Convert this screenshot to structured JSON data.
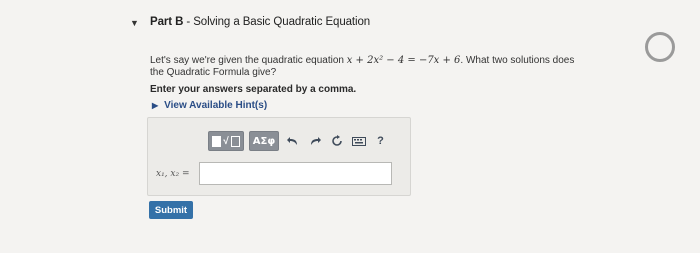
{
  "part": {
    "expand_icon": "caret-down-icon",
    "label": "Part B",
    "separator": " - ",
    "title": "Solving a Basic Quadratic Equation"
  },
  "question": {
    "text_before": "Let's say we're given the quadratic equation ",
    "equation": "x + 2x² − 4 = −7x + 6",
    "text_after": ". What two solutions does the Quadratic Formula give?"
  },
  "instruction": "Enter your answers separated by a comma.",
  "hints": {
    "icon": "triangle-right-icon",
    "label": "View Available Hint(s)"
  },
  "toolbar": {
    "template_label": "√",
    "greek_label": "ΑΣφ",
    "undo_icon": "undo-icon",
    "redo_icon": "redo-icon",
    "reset_icon": "reset-icon",
    "keyboard_icon": "keyboard-icon",
    "help_label": "?"
  },
  "answer": {
    "variable_label": "x₁, x₂ =",
    "value": ""
  },
  "submit_label": "Submit",
  "colors": {
    "submit": "#3471a8",
    "hint_link": "#2a4d86",
    "toolbar_button": "#8a8f96"
  }
}
